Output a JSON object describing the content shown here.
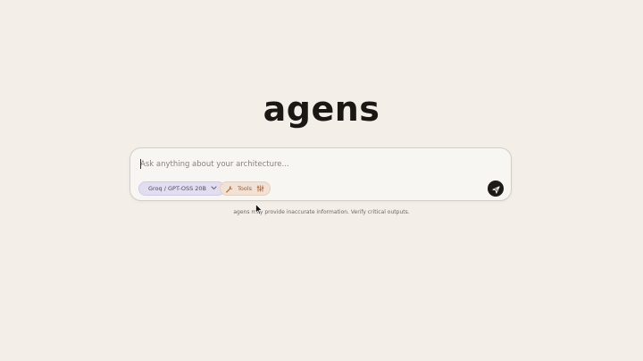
{
  "app": {
    "logo_text": "agens"
  },
  "composer": {
    "placeholder": "Ask anything about your architecture...",
    "value": "",
    "model_label": "Groq / GPT-OSS 20B",
    "tools_label": "Tools",
    "icons": {
      "model_dropdown": "chevron-down-icon",
      "tools": "wrench-icon",
      "tools_settings": "sliders-icon",
      "send": "send-icon"
    }
  },
  "disclaimer": {
    "text": "agens may provide inaccurate information. Verify critical outputs."
  },
  "colors": {
    "background": "#f3efe8",
    "composer_bg": "#f8f6f2",
    "model_pill": "#e2def0",
    "tools_pill": "#f0e2d6",
    "tools_accent": "#c26b3a",
    "send_button": "#1e1a17"
  }
}
